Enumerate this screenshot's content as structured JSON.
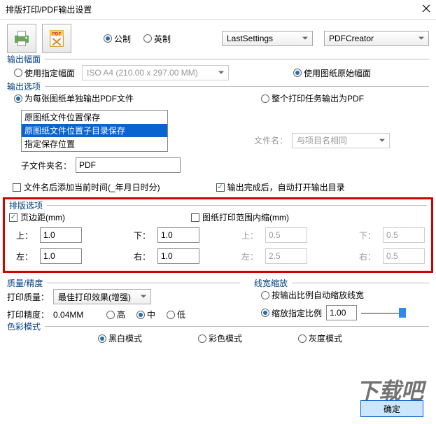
{
  "window": {
    "title": "排版打印/PDF输出设置"
  },
  "top": {
    "metric": "公制",
    "imperial": "英制",
    "preset": "LastSettings",
    "printer": "PDFCreator"
  },
  "frameSize": {
    "legend": "输出幅面",
    "useFixed": "使用指定幅面",
    "paper": "ISO A4 (210.00 x 297.00 MM)",
    "useOriginal": "使用图纸原始幅面"
  },
  "outOpt": {
    "legend": "输出选项",
    "perSheet": "为每张图纸单独输出PDF文件",
    "wholeJob": "整个打印任务输出为PDF",
    "listItems": [
      "原图纸文件位置保存",
      "原图纸文件位置子目录保存",
      "指定保存位置"
    ],
    "subdirLbl": "子文件夹名：",
    "subdirVal": "PDF",
    "fileNameLbl": "文件名：",
    "fileNameVal": "与项目名相同",
    "appendTime": "文件名后添加当前时间(_年月日时分)",
    "autoOpen": "输出完成后，自动打开输出目录"
  },
  "layout": {
    "legend": "排版选项",
    "marginChk": "页边距(mm)",
    "shrinkChk": "图纸打印范围内缩(mm)",
    "top": "上：",
    "bottom": "下：",
    "left": "左：",
    "right": "右：",
    "m_top": "1.0",
    "m_bottom": "1.0",
    "m_left": "1.0",
    "m_right": "1.0",
    "s_top": "0.5",
    "s_bottom": "0.5",
    "s_left": "2.5",
    "s_right": "0.5"
  },
  "quality": {
    "legend": "质量/精度",
    "qualLbl": "打印质量：",
    "qualVal": "最佳打印效果(增强)",
    "precLbl": "打印精度：",
    "precVal": "0.04MM",
    "hi": "高",
    "mid": "中",
    "lo": "低"
  },
  "lineWidth": {
    "legend": "线宽缩放",
    "byRatio": "按输出比例自动缩放线宽",
    "fixed": "缩放指定比例",
    "fixedVal": "1.00"
  },
  "colorMode": {
    "legend": "色彩模式",
    "bw": "黑白模式",
    "color": "彩色模式",
    "gray": "灰度模式"
  },
  "ok": "确定",
  "watermark": "下载吧"
}
